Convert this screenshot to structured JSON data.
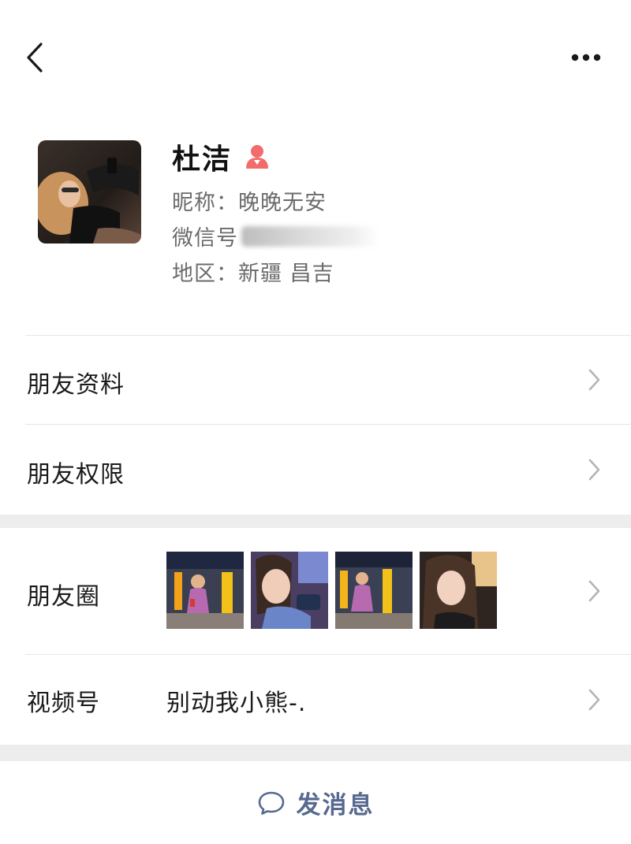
{
  "header": {
    "back_icon": "chevron-left-icon",
    "more_icon": "more-dots-icon"
  },
  "profile": {
    "name": "杜洁",
    "gender_icon": "female-icon",
    "gender_color": "#f26c6c",
    "nickname": "昵称：晚晚无安",
    "wechat_id_label": "微信号",
    "region": "地区：新疆 昌吉"
  },
  "menu": {
    "friend_info": "朋友资料",
    "friend_permissions": "朋友权限",
    "moments_label": "朋友圈",
    "channels_label": "视频号",
    "channels_value": "别动我小熊-."
  },
  "actions": {
    "send_message": "发消息",
    "send_icon": "chat-bubble-icon",
    "accent_color": "#56698f"
  }
}
